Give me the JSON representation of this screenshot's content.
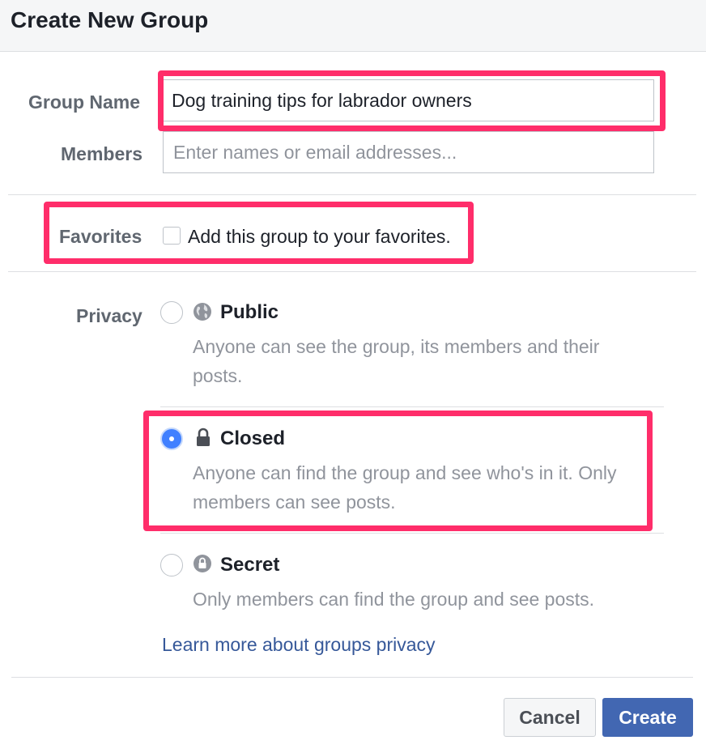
{
  "dialog": {
    "title": "Create New Group"
  },
  "form": {
    "group_name": {
      "label": "Group Name",
      "value": "Dog training tips for labrador owners"
    },
    "members": {
      "label": "Members",
      "placeholder": "Enter names or email addresses..."
    },
    "favorites": {
      "label": "Favorites",
      "checkbox_text": "Add this group to your favorites.",
      "checked": false
    },
    "privacy": {
      "label": "Privacy",
      "selected": "Closed",
      "options": [
        {
          "title": "Public",
          "icon": "globe-icon",
          "description_line1": "Anyone can see the group, its members and their",
          "description_line2": "posts."
        },
        {
          "title": "Closed",
          "icon": "lock-icon",
          "description_line1": "Anyone can find the group and see who's in it. Only",
          "description_line2": "members can see posts."
        },
        {
          "title": "Secret",
          "icon": "secret-lock-icon",
          "description_line1": "Only members can find the group and see posts.",
          "description_line2": ""
        }
      ],
      "learn_more": "Learn more about groups privacy"
    }
  },
  "footer": {
    "cancel_label": "Cancel",
    "create_label": "Create"
  },
  "colors": {
    "highlight": "#ff2d6a",
    "primary_button": "#4267b2",
    "link": "#365899",
    "radio_checked": "#4080ff"
  }
}
